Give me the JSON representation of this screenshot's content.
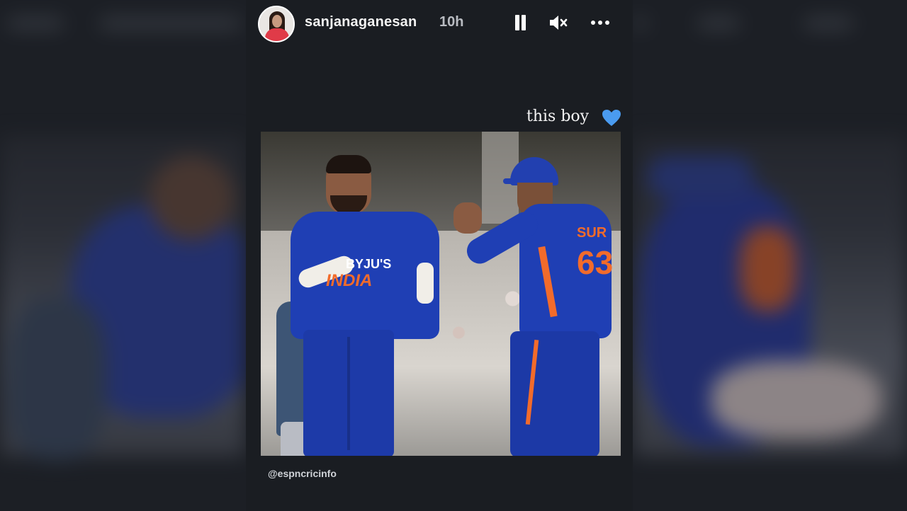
{
  "story": {
    "username": "sanjanaganesan",
    "time_ago": "10h",
    "caption": "this boy",
    "caption_emoji": "blue-heart-icon",
    "photo_credit": "@espncricinfo",
    "controls": {
      "pause": "pause-icon",
      "mute": "speaker-muted-icon",
      "more": "more-horizontal-icon"
    },
    "photo_alt": "Two cricketers in blue India jerseys high-fiving on the field",
    "jersey_text_left": [
      "BYJU'S",
      "INDIA"
    ],
    "jersey_text_right": [
      "SUR",
      "63"
    ]
  },
  "colors": {
    "background": "#1c1f25",
    "text": "#f2f2f2",
    "muted_text": "#b9bcc2",
    "jersey_blue": "#1f3fb4",
    "jersey_orange": "#f26b2b",
    "heart": "#4a9bf0"
  }
}
